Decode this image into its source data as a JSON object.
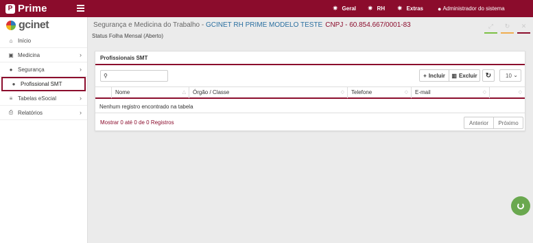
{
  "topbar": {
    "brand": "Prime",
    "nav": [
      {
        "label": "Geral",
        "icon": "gear-icon"
      },
      {
        "label": "RH",
        "icon": "gear-icon"
      },
      {
        "label": "Extras",
        "icon": "gears-icon"
      }
    ],
    "user": "Administrador do sistema",
    "user_icon": "user-icon"
  },
  "sidebar": {
    "logo_text": "gcinet",
    "items": [
      {
        "label": "Início",
        "icon": "home-icon",
        "has_children": false
      },
      {
        "label": "Medicina",
        "icon": "medkit-icon",
        "has_children": true
      },
      {
        "label": "Segurança",
        "icon": "user-icon",
        "has_children": true
      },
      {
        "label": "Profissional SMT",
        "icon": "user-icon",
        "has_children": false,
        "active": true
      },
      {
        "label": "Tabelas eSocial",
        "icon": "list-icon",
        "has_children": true
      },
      {
        "label": "Relatórios",
        "icon": "print-icon",
        "has_children": true
      }
    ]
  },
  "header": {
    "title_prefix": "Segurança e Medicina do Trabalho - ",
    "company": "GCINET RH PRIME MODELO TESTE",
    "cnpj": "CNPJ - 60.854.667/0001-83",
    "status": "Status Folha Mensal (Aberto)"
  },
  "panel": {
    "title": "Profissionais SMT",
    "search_placeholder": "",
    "buttons": {
      "incluir": "Incluir",
      "excluir": "Excluir"
    },
    "page_size": "10",
    "columns": [
      "Nome",
      "Órgão / Classe",
      "Telefone",
      "E-mail"
    ],
    "empty_message": "Nenhum registro encontrado na tabela",
    "footer_info": "Mostrar 0 até 0 de 0 Registros",
    "pagination": {
      "prev": "Anterior",
      "next": "Próximo"
    }
  },
  "colors": {
    "brand": "#8b0c2c",
    "company_text": "#2a6fa0",
    "expand_bar": "#7bc043",
    "refresh_bar": "#f0ad4e",
    "close_bar": "#8b0c2c",
    "chat": "#6aa84f"
  }
}
